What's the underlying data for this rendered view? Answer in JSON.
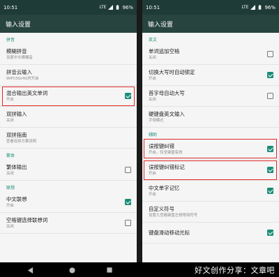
{
  "colors": {
    "accent": "#1b8c77",
    "status_bar": "#1f3b37",
    "app_bar": "#27443f",
    "highlight": "#e02828",
    "background": "#f5f5f5"
  },
  "left": {
    "status": {
      "time": "10:51",
      "network": "LTE",
      "battery": "96%"
    },
    "title": "输入设置",
    "sections": [
      {
        "header": "拼音",
        "items": [
          {
            "title": "模糊拼音",
            "subtitle": "设置中文模糊音"
          },
          {
            "title": "拼音云输入",
            "subtitle": "WIFI/3G/4G时开启"
          },
          {
            "title": "混合输出英文单词",
            "subtitle": "开启",
            "checked": true,
            "highlighted": true
          },
          {
            "title": "双拼输入",
            "subtitle": "关闭"
          },
          {
            "title": "双拼指南",
            "subtitle": "查看双拼方案说明"
          }
        ]
      },
      {
        "header": "繁体",
        "items": [
          {
            "title": "繁体输出",
            "subtitle": "关闭",
            "checked": false
          }
        ]
      },
      {
        "header": "联想",
        "items": [
          {
            "title": "中文联想",
            "subtitle": "开启",
            "checked": true
          },
          {
            "title": "空格键选择联想词",
            "subtitle": "关闭",
            "checked": false
          }
        ]
      }
    ]
  },
  "right": {
    "status": {
      "time": "10:51",
      "network": "LTE",
      "battery": "96%"
    },
    "title": "输入设置",
    "sections": [
      {
        "header": "英文",
        "items": [
          {
            "title": "单词追加空格",
            "subtitle": "关闭",
            "checked": false
          },
          {
            "title": "切换大写时自动锁定",
            "subtitle": "开启",
            "checked": true
          },
          {
            "title": "首字母自动大写",
            "subtitle": "关闭",
            "checked": false
          },
          {
            "title": "硬键盘英文输入",
            "subtitle": "字母模式"
          }
        ]
      },
      {
        "header": "辅助",
        "items": [
          {
            "title": "误按键纠错",
            "subtitle": "开启，仅全键盘有效",
            "checked": true,
            "highlighted": true
          },
          {
            "title": "误按键纠错标记",
            "subtitle": "开启",
            "checked": true,
            "highlighted": true
          },
          {
            "title": "中文单字记忆",
            "subtitle": "开启",
            "checked": true
          },
          {
            "title": "自定义符号",
            "subtitle": "设置九宫格键盘左侧常用符号"
          },
          {
            "title": "键盘滑动移动光标",
            "subtitle": "",
            "checked": true
          }
        ]
      }
    ]
  },
  "navbar": {
    "back_icon": "back-triangle-icon",
    "home_icon": "home-circle-icon",
    "recents_icon": "recents-square-icon"
  },
  "watermark": "好文创作分享：文章吧"
}
